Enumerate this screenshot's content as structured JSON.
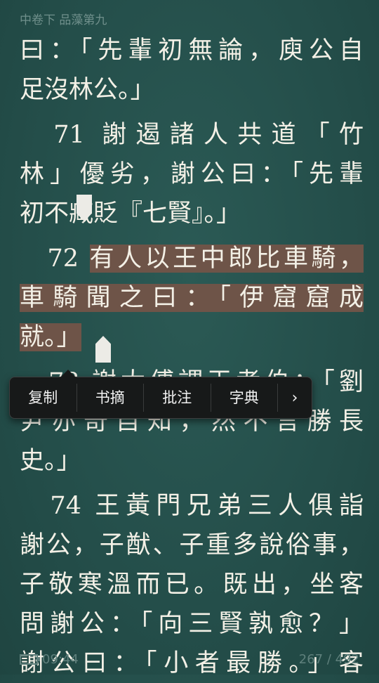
{
  "chapter_title": "中卷下 品藻第九",
  "lines": [
    "曰：「先輩初無論，庾公自",
    "足沒林公。」",
    "　71 謝遏諸人共道「竹",
    "林」優劣，謝公曰：「先輩",
    "初不臧貶『七賢』。」",
    "　72 ",
    "有人以王中郎比車騎，",
    "車騎聞之曰：「伊窟窟成",
    "就。」",
    "　73 謝太傅謂王孝伯：「劉",
    "尹亦奇自知，然不言勝長",
    "史。」",
    "　74 王黃門兄弟三人俱詣",
    "謝公，子猷、子重多說俗事，",
    "子敬寒溫而已。既出，坐客",
    "問謝公：「向三賢孰愈？」",
    "謝公曰：「小者最勝。」客"
  ],
  "context_menu": {
    "copy": "复制",
    "excerpt": "书摘",
    "annotate": "批注",
    "dictionary": "字典",
    "more": "›"
  },
  "status": {
    "time": "09:44",
    "page": "267 / 492"
  }
}
